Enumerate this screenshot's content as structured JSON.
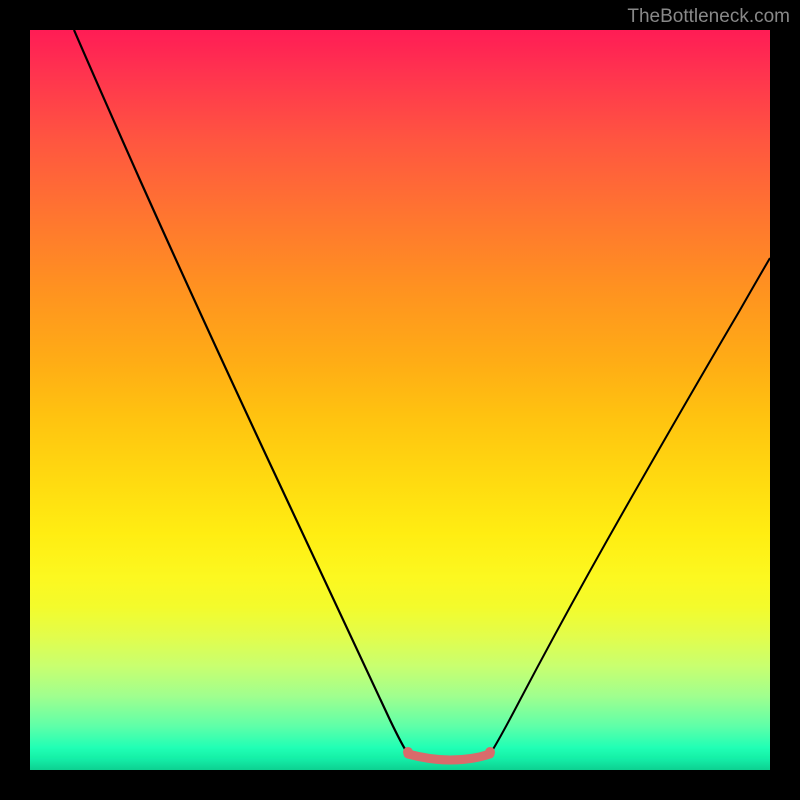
{
  "watermark": "TheBottleneck.com",
  "chart_data": {
    "type": "line",
    "title": "",
    "xlabel": "",
    "ylabel": "",
    "xlim": [
      0,
      100
    ],
    "ylim": [
      0,
      100
    ],
    "series": [
      {
        "name": "left-curve",
        "x": [
          6,
          10,
          15,
          20,
          25,
          30,
          35,
          40,
          45,
          49,
          51
        ],
        "values": [
          100,
          91,
          79,
          68,
          57,
          46,
          35,
          24,
          13,
          4,
          2
        ]
      },
      {
        "name": "right-curve",
        "x": [
          62,
          64,
          68,
          72,
          76,
          80,
          84,
          88,
          92,
          96,
          100
        ],
        "values": [
          2,
          4,
          10,
          17,
          24,
          32,
          40,
          48,
          56,
          64,
          72
        ]
      }
    ],
    "flat_region": {
      "x_start": 50,
      "x_end": 63,
      "y": 1.5
    },
    "background_gradient": {
      "type": "vertical",
      "stops": [
        {
          "pos": 0,
          "color": "#ff1c55"
        },
        {
          "pos": 50,
          "color": "#ffc210"
        },
        {
          "pos": 75,
          "color": "#fcf820"
        },
        {
          "pos": 100,
          "color": "#0fd898"
        }
      ]
    }
  }
}
